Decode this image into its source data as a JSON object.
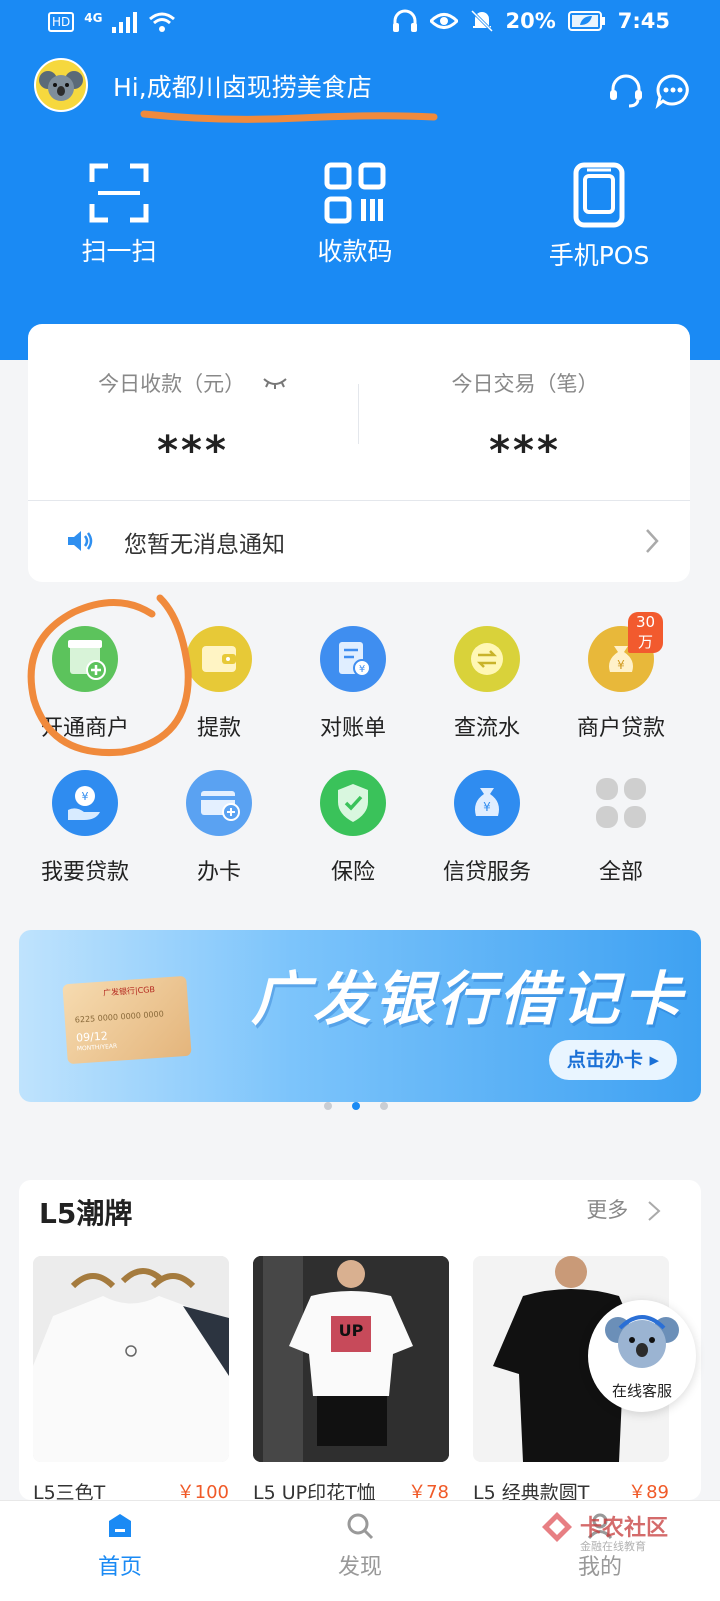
{
  "status_bar": {
    "network": "4G",
    "hd": "HD",
    "battery": "20%",
    "time": "7:45"
  },
  "header": {
    "greeting": "Hi,成都川卤现捞美食店",
    "quick_actions": [
      {
        "label": "扫一扫",
        "icon": "scan-icon"
      },
      {
        "label": "收款码",
        "icon": "qr-code-icon"
      },
      {
        "label": "手机POS",
        "icon": "pos-device-icon"
      }
    ]
  },
  "summary": {
    "today_income_label": "今日收款（元）",
    "today_income_value": "***",
    "today_tx_label": "今日交易（笔）",
    "today_tx_value": "***",
    "notice": "您暂无消息通知"
  },
  "grid": {
    "items": [
      {
        "label": "开通商户",
        "icon": "open-merchant-icon",
        "color": "#5cc35c"
      },
      {
        "label": "提款",
        "icon": "wallet-icon",
        "color": "#e7c937"
      },
      {
        "label": "对账单",
        "icon": "statement-icon",
        "color": "#3f8ef0"
      },
      {
        "label": "查流水",
        "icon": "transfer-icon",
        "color": "#d9d23a"
      },
      {
        "label": "商户贷款",
        "icon": "money-bag-icon",
        "color": "#e8b83a",
        "badge": "30万"
      },
      {
        "label": "我要贷款",
        "icon": "loan-hand-icon",
        "color": "#2f8cf0"
      },
      {
        "label": "办卡",
        "icon": "add-card-icon",
        "color": "#5aa2f2"
      },
      {
        "label": "保险",
        "icon": "shield-check-icon",
        "color": "#3ac25a"
      },
      {
        "label": "信贷服务",
        "icon": "credit-bag-icon",
        "color": "#2f8cf0"
      },
      {
        "label": "全部",
        "icon": "all-grid-icon",
        "color": "#c9c9c9"
      }
    ]
  },
  "banner": {
    "title": "广发银行借记卡",
    "button": "点击办卡",
    "card_bank": "广发银行|CGB",
    "card_number": "6225 0000 0000 0000",
    "card_expiry": "09/12",
    "card_expiry_label": "MONTH/YEAR"
  },
  "section": {
    "title": "L5潮牌",
    "more": "更多",
    "products": [
      {
        "name": "L5三色T",
        "price": "￥100"
      },
      {
        "name": "L5 UP印花T恤",
        "price": "￥78"
      },
      {
        "name": "L5 经典款圆T",
        "price": "￥89"
      }
    ]
  },
  "customer_service": {
    "label": "在线客服"
  },
  "tabbar": {
    "items": [
      {
        "label": "首页"
      },
      {
        "label": "发现"
      },
      {
        "label": "我的"
      }
    ]
  },
  "watermark": {
    "title": "卡农社区",
    "subtitle": "金融在线教育"
  },
  "colors": {
    "primary": "#1a8af4",
    "annotation": "#f08a3c",
    "price": "#f05a28"
  }
}
